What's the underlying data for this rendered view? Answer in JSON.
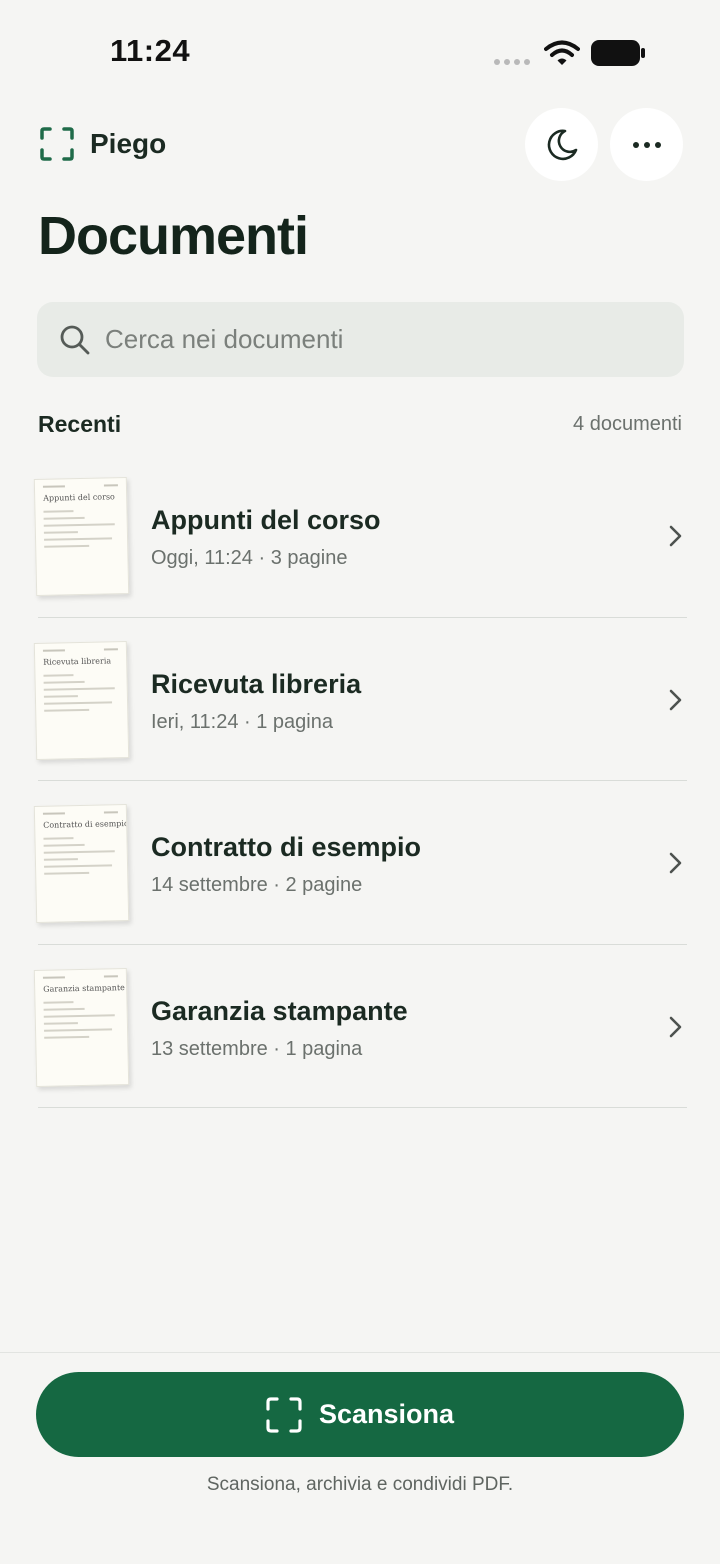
{
  "status_bar": {
    "time": "11:24"
  },
  "header": {
    "brand_name": "Piego",
    "title": "Documenti"
  },
  "search": {
    "placeholder": "Cerca nei documenti"
  },
  "section": {
    "title": "Recenti",
    "count": "4 documenti"
  },
  "documents": [
    {
      "title": "Appunti del corso",
      "meta": "Oggi, 11:24 · 3 pagine"
    },
    {
      "title": "Ricevuta libreria",
      "meta": "Ieri, 11:24 · 1 pagina"
    },
    {
      "title": "Contratto di esempio",
      "meta": "14 settembre · 2 pagine"
    },
    {
      "title": "Garanzia stampante",
      "meta": "13 settembre · 1 pagina"
    }
  ],
  "scan_button": {
    "label": "Scansiona"
  },
  "footer": {
    "text": "Scansiona, archivia e condividi PDF."
  },
  "colors": {
    "accent": "#156842",
    "background": "#f5f5f3",
    "text": "#1b2a22"
  }
}
